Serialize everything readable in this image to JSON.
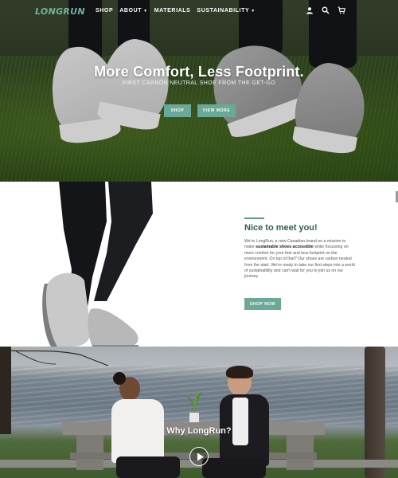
{
  "brand": {
    "logo": "LONGRUN",
    "accent": "#6aa897"
  },
  "nav": {
    "items": [
      {
        "label": "SHOP",
        "has_caret": false
      },
      {
        "label": "ABOUT",
        "has_caret": true
      },
      {
        "label": "MATERIALS",
        "has_caret": false
      },
      {
        "label": "SUSTAINABILITY",
        "has_caret": true
      }
    ],
    "icons": [
      "user-icon",
      "search-icon",
      "cart-icon"
    ]
  },
  "hero": {
    "title": "More Comfort, Less Footprint.",
    "subtitle": "FIRST CARBON NEUTRAL SHOE FROM THE GET-GO",
    "shop_label": "SHOP",
    "view_more_label": "VIEW MORE"
  },
  "about": {
    "heading": "Nice to meet you!",
    "text_1": "We're LongRun, a new Canadian brand on a mission to make ",
    "text_bold": "sustainable shoes accessible",
    "text_2": " while focussing on more comfort for your feet and less footprint on the environment. On top of that? Our shoes are carbon neutral from the start. We're ready to take our first steps into a world of sustainability and can't wait for you to join us on our journey.",
    "shop_now_label": "SHOP NOW"
  },
  "video": {
    "title": "Why LongRun?",
    "icons": [
      "play-icon"
    ]
  }
}
